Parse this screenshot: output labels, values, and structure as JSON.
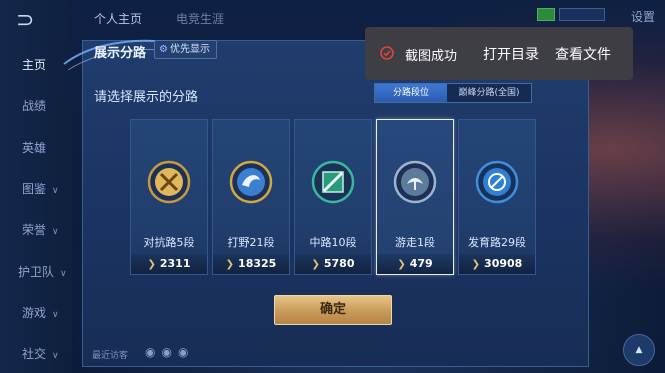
{
  "top_tabs": [
    "个人主页",
    "电竞生涯"
  ],
  "settings_label": "设置",
  "nav": [
    {
      "label": "主页",
      "chevron": false
    },
    {
      "label": "战绩",
      "chevron": false
    },
    {
      "label": "英雄",
      "chevron": false
    },
    {
      "label": "图鉴",
      "chevron": true
    },
    {
      "label": "荣誉",
      "chevron": true
    },
    {
      "label": "护卫队",
      "chevron": true
    },
    {
      "label": "游戏",
      "chevron": true
    },
    {
      "label": "社交",
      "chevron": true
    }
  ],
  "panel": {
    "title": "展示分路",
    "priority_label": "优先显示",
    "prompt": "请选择展示的分路",
    "segments": [
      "分路段位",
      "巅峰分路(全国)"
    ],
    "active_segment": 0,
    "confirm_label": "确定"
  },
  "lanes": [
    {
      "name": "对抗路5段",
      "score": "2311",
      "selected": false,
      "emblem_color": "#c99a3a",
      "emblem_icon": "crossed-swords-icon"
    },
    {
      "name": "打野21段",
      "score": "18325",
      "selected": false,
      "emblem_color": "#d2a842",
      "emblem_icon": "dragon-icon"
    },
    {
      "name": "中路10段",
      "score": "5780",
      "selected": false,
      "emblem_color": "#39b89a",
      "emblem_icon": "mid-lane-icon"
    },
    {
      "name": "游走1段",
      "score": "479",
      "selected": true,
      "emblem_color": "#9fb4cc",
      "emblem_icon": "support-icon"
    },
    {
      "name": "发育路29段",
      "score": "30908",
      "selected": false,
      "emblem_color": "#3c8fe0",
      "emblem_icon": "bow-icon"
    }
  ],
  "toast": {
    "message": "截图成功",
    "open_dir_label": "打开目录",
    "view_file_label": "查看文件",
    "accent": "#e0443a"
  },
  "footer": {
    "visitors_label": "最近访客"
  }
}
